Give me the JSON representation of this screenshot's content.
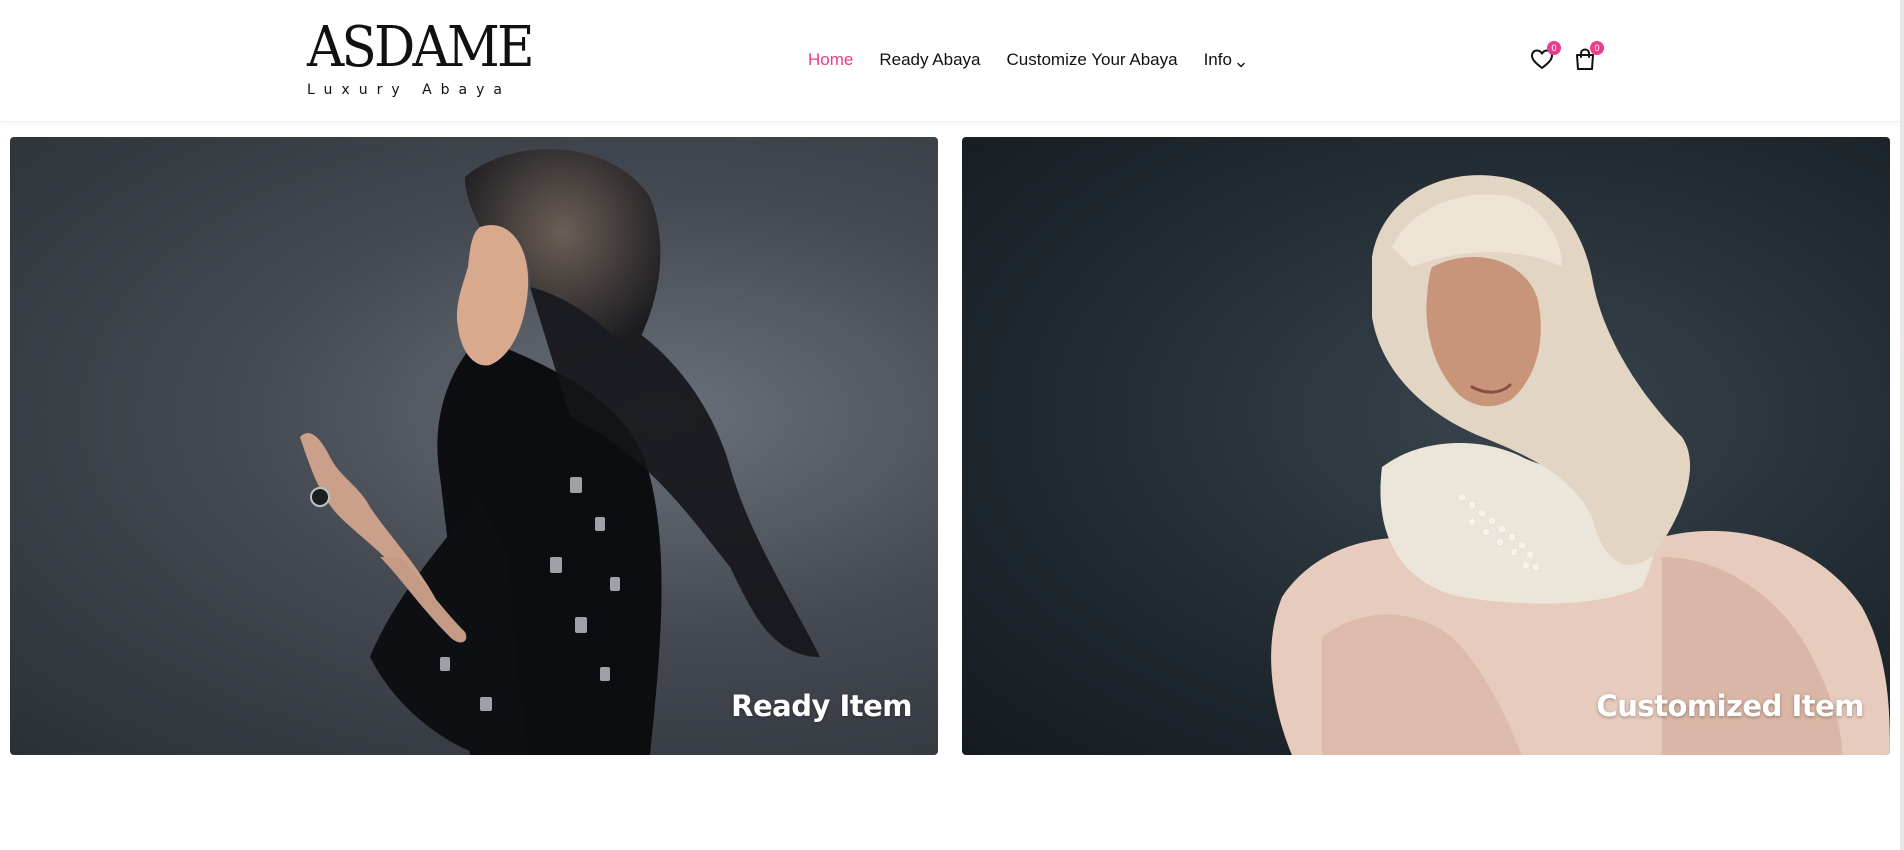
{
  "header": {
    "logo": {
      "main": "ASDAME",
      "sub": "Luxury Abaya"
    },
    "nav": [
      {
        "label": "Home",
        "active": true
      },
      {
        "label": "Ready Abaya",
        "active": false
      },
      {
        "label": "Customize Your Abaya",
        "active": false
      },
      {
        "label": "Info",
        "active": false,
        "has_dropdown": true
      }
    ],
    "icons": {
      "wishlist": {
        "icon": "heart-icon",
        "count": "0"
      },
      "cart": {
        "icon": "shopping-bag-icon",
        "count": "0"
      }
    }
  },
  "cards": [
    {
      "label": "Ready Item"
    },
    {
      "label": "Customized Item"
    }
  ],
  "colors": {
    "accent": "#e83e8c",
    "text": "#111111",
    "background": "#ffffff"
  }
}
